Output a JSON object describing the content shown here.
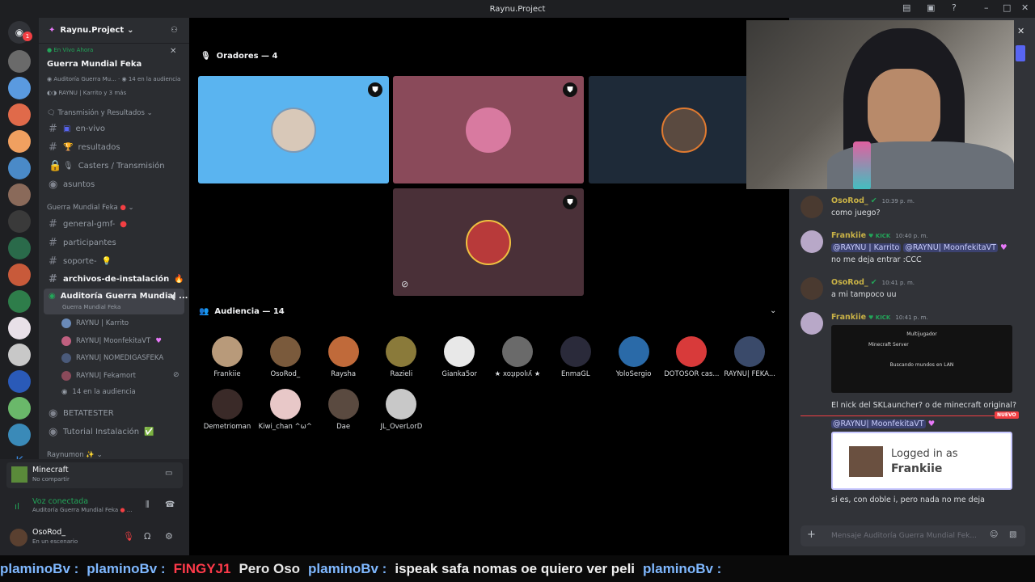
{
  "titlebar": {
    "title": "Raynu.Project"
  },
  "server_badge": "1",
  "channels": {
    "server_name": "Raynu.Project",
    "live": {
      "label": "En Vivo Ahora",
      "title": "Guerra Mundial Feka",
      "line1": "Auditoría Guerra Mu...",
      "aud": "14 en la audiencia",
      "users": "RAYNU | Karrito y 3 más"
    },
    "cat1": "Transmisión y Resultados",
    "c1": "en-vivo",
    "c2": "resultados",
    "c3": "Casters / Transmisión",
    "c4": "asuntos",
    "cat2": "Guerra Mundial Feka",
    "c5": "general-gmf-",
    "c6": "participantes",
    "c7": "soporte-",
    "c8": "archivos-de-instalación",
    "stage": "Auditoría Guerra Mundial ...",
    "stage_sub": "Guerra Mundial Feka",
    "vu1": "RAYNU | Karrito",
    "vu2": "RAYNU| MoonfekitaVT",
    "vu3": "RAYNU| NOMEDIGASFEKA",
    "vu4": "RAYNU| Fekamort",
    "vu5": "14 en la audiencia",
    "c9": "BETATESTER",
    "c10": "Tutorial Instalación",
    "cat3": "Raynumon"
  },
  "panel": {
    "activity": "Minecraft",
    "activity_sub": "No compartir",
    "voice": "Voz conectada",
    "voice_sub": "Auditoría Guerra Mundial Feka",
    "user": "OsoRod_",
    "user_status": "En un escenario"
  },
  "stage": {
    "speakers": "Oradores — 4",
    "audience": "Audiencia — 14"
  },
  "audience": [
    {
      "name": "Frankiie",
      "color": "#b89a7a"
    },
    {
      "name": "OsoRod_",
      "color": "#7a5a3c"
    },
    {
      "name": "Raysha",
      "color": "#c06a3a"
    },
    {
      "name": "Razieli",
      "color": "#8a7a3a"
    },
    {
      "name": "Gianka5or",
      "color": "#e8e8e8"
    },
    {
      "name": "★ xoʇıpolıʎ ★",
      "color": "#6a6a6a"
    },
    {
      "name": "EnmaGL",
      "color": "#2a2a3a"
    },
    {
      "name": "YoloSergio",
      "color": "#2a6aa8"
    },
    {
      "name": "DOTOSOR cas...",
      "color": "#d83a3a"
    },
    {
      "name": "RAYNU| FEKA...",
      "color": "#3a4a6a"
    },
    {
      "name": "Demetrioman",
      "color": "#3a2a28"
    },
    {
      "name": "Kiwi_chan ^ω^",
      "color": "#e8c8c8"
    },
    {
      "name": "Dae",
      "color": "#5a4a40"
    },
    {
      "name": "JL_OverLorD",
      "color": "#c8c8c8"
    }
  ],
  "chat": {
    "m1": {
      "user": "OsoRod_",
      "time": "10:39 p. m.",
      "text": "como juego?"
    },
    "m2": {
      "user": "Frankiie",
      "tag": "KICK",
      "time": "10:40 p. m.",
      "mention1": "@RAYNU | Karrito",
      "mention2": "@RAYNU| MoonfekitaVT",
      "text": "no me deja entrar :CCC"
    },
    "m3": {
      "user": "OsoRod_",
      "time": "10:41 p. m.",
      "text": "a mi tampoco uu"
    },
    "m4": {
      "user": "Frankiie",
      "tag": "KICK",
      "time": "10:41 p. m.",
      "text": "El nick del SKLauncher? o de minecraft original?",
      "reply": "@RAYNU| MoonfekitaVT",
      "new_label": "NUEVO",
      "embed1": "Logged in as",
      "embed2": "Frankiie",
      "text2": "si es, con doble i, pero nada no me deja"
    },
    "mc_title": "Multijugador",
    "mc_server": "Minecraft Server",
    "mc_search": "Buscando mundos en LAN",
    "input_placeholder": "Mensaje Auditoría Guerra Mundial Fek..."
  },
  "ticker": [
    {
      "text": "plaminoBv :",
      "color": "#7fb8ff"
    },
    {
      "text": "plaminoBv :",
      "color": "#7fb8ff"
    },
    {
      "text": "FINGYJ1",
      "color": "#ff3a4a"
    },
    {
      "text": "Pero Oso",
      "color": "#e8e8e8"
    },
    {
      "text": "plaminoBv :",
      "color": "#7fb8ff"
    },
    {
      "text": "ispeak safa nomas oe quiero ver peli",
      "color": "#f0f0f0"
    },
    {
      "text": "plaminoBv :",
      "color": "#7fb8ff"
    }
  ]
}
